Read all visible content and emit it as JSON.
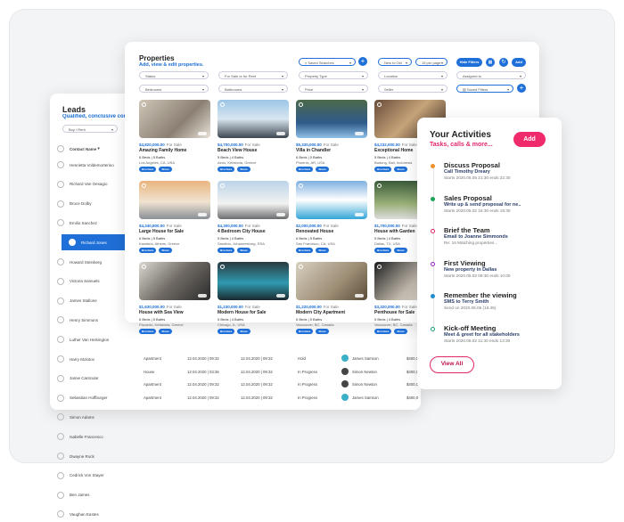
{
  "leads": {
    "title": "Leads",
    "subtitle": "Qualified, conclusive connections",
    "filter": "Buy / Rent",
    "column": "Contact Name",
    "contacts": [
      "Henrietta Voldemorterino",
      "Richard Van Oesagio",
      "Bruce Dolby",
      "Emilio Sanchez",
      "Richard Jones",
      "Howard Steinberg",
      "Victoria Samuels",
      "James Stallone",
      "Henry Simmons",
      "Luther Van Helsington",
      "Harry Molotov",
      "Jamie Cantcular",
      "Sebastian Hoffburger",
      "Simon Adams",
      "Isabelle Francesco",
      "Dwayne Rock",
      "Cedrick Von Stayer",
      "Ben James",
      "Vaughan Eastes"
    ],
    "selected": "Richard Jones",
    "rows": [
      {
        "type": "Apartment",
        "start": "12.04.2020 | 09:32",
        "end": "12.04.2020 | 09:32",
        "status": "Hold",
        "agent": "James Samson",
        "price": "$400,0"
      },
      {
        "type": "House",
        "start": "12.04.2020 | 03:36",
        "end": "12.04.2020 | 09:32",
        "status": "In Progress",
        "agent": "Simon Newton",
        "price": "$400,0"
      },
      {
        "type": "Apartment",
        "start": "12.04.2020 | 09:32",
        "end": "12.04.2020 | 09:32",
        "status": "In Progress",
        "agent": "Simon Newton",
        "price": "$400,0"
      },
      {
        "type": "Apartment",
        "start": "12.04.2020 | 09:32",
        "end": "12.04.2020 | 09:32",
        "status": "In Progress",
        "agent": "James Samson",
        "price": "$400,0"
      }
    ]
  },
  "properties": {
    "title": "Properties",
    "subtitle": "Add, view & edit properties.",
    "saved_searches": "Saved Searches",
    "sort": "New to Old",
    "per_page": "15 per page",
    "hide_filters": "Hide Filters",
    "add": "Add",
    "filters": [
      "Status",
      "For Sale or for Rent",
      "Property Type",
      "Location",
      "Assigned to",
      "Bedrooms",
      "Bathrooms",
      "Price",
      "Seller"
    ],
    "saved_filters": "Saved Filters",
    "brochure": "Brochure",
    "share": "Share",
    "listings": [
      {
        "price": "$4,820,000.00",
        "status": "For Sale",
        "name": "Amazing Family Home",
        "beds": "6 Beds | 5 Baths",
        "location": "Los Angeles, CA, USA"
      },
      {
        "price": "$4,700,000.00",
        "status": "For Sale",
        "name": "Beach View House",
        "beds": "5 Beds | 4 Baths",
        "location": "Aeos, Kefalonia, Greece"
      },
      {
        "price": "$5,330,000.00",
        "status": "For Sale",
        "name": "Villa in Chandler",
        "beds": "6 Beds | 5 Baths",
        "location": "Phoenix, AR, USA"
      },
      {
        "price": "$4,232,000.00",
        "status": "For Sale",
        "name": "Exceptional Home",
        "beds": "5 Beds | 4 Baths",
        "location": "Badung, Bali, Indonesia"
      },
      {
        "price": "$4,340,800.00",
        "status": "For Sale",
        "name": "Large House for Sale",
        "beds": "6 Beds | 5 Baths",
        "location": "Karatsini, Athens, Greece"
      },
      {
        "price": "$4,300,000.00",
        "status": "For Sale",
        "name": "4 Bedroom City House",
        "beds": "5 Beds | 4 Baths",
        "location": "Sandton, Johannesburg, RSA"
      },
      {
        "price": "$2,000,000.00",
        "status": "For Sale",
        "name": "Renovated House",
        "beds": "6 Beds | 5 Baths",
        "location": "San Francisco, CA, USA"
      },
      {
        "price": "$1,700,000.00",
        "status": "For Sale",
        "name": "House with Garden",
        "beds": "5 Beds | 4 Baths",
        "location": "Dallas, TX, USA"
      },
      {
        "price": "$1,630,000.00",
        "status": "For Sale",
        "name": "House with Sea View",
        "beds": "6 Beds | 5 Baths",
        "location": "Fiscardo, Kefalonia, Greece"
      },
      {
        "price": "$1,230,000.00",
        "status": "For Sale",
        "name": "Modern House for Sale",
        "beds": "5 Beds | 4 Baths",
        "location": "Chicago, IL, USA"
      },
      {
        "price": "$1,220,000.00",
        "status": "For Sale",
        "name": "Modern City Apartment",
        "beds": "6 Beds | 5 Baths",
        "location": "Vancouver, BC, Canada"
      },
      {
        "price": "$3,320,000.00",
        "status": "For Sale",
        "name": "Penthouse for Sale",
        "beds": "5 Beds | 4 Baths",
        "location": "Vancouver, BC, Canada"
      }
    ]
  },
  "activities": {
    "title": "Your Activities",
    "subtitle": "Tasks, calls & more...",
    "add": "Add",
    "view_all": "View All",
    "items": [
      {
        "title": "Discuss Proposal",
        "sub": "Call Timothy Dreary",
        "meta": "Starts 2020.05.05 21:30 ends 22:30",
        "color": "#f0922b",
        "hollow": false
      },
      {
        "title": "Sales Proposal",
        "sub": "Write up & send proposal for ne..",
        "meta": "Starts 2020.05.02 16:30 ends 19:30",
        "color": "#1ea35a",
        "hollow": false
      },
      {
        "title": "Brief the Team",
        "sub": "Email to Joanne Simmonds",
        "meta": "Re: 16 Matching properties...",
        "color": "#e3256b",
        "hollow": true
      },
      {
        "title": "First Viewing",
        "sub": "New property in Dallas",
        "meta": "Starts 2020.05.02 09:30 ends 10:00",
        "color": "#9b1fc4",
        "hollow": true
      },
      {
        "title": "Remember the viewing",
        "sub": "SMS to Terry Smith",
        "meta": "Send on 2020.06.06 (16:45)",
        "color": "#1f8fd0",
        "hollow": false
      },
      {
        "title": "Kick-off Meeting",
        "sub": "Meet & greet for all stakeholders",
        "meta": "Starts 2020.05.02 11:30 ends 13:30",
        "color": "#19a07a",
        "hollow": true
      }
    ]
  }
}
